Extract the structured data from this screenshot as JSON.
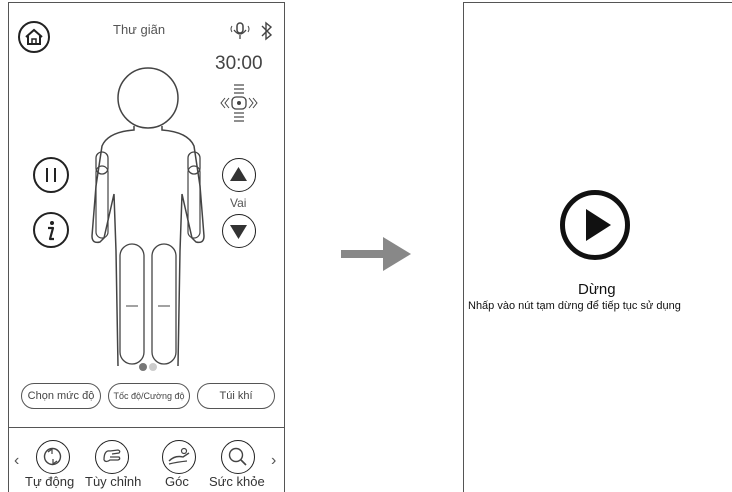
{
  "left": {
    "title": "Thư giãn",
    "timer": "30:00",
    "side_label": "Vai",
    "pager_dots": 2,
    "mode_buttons": [
      "Chọn mức độ",
      "Tốc độ/Cường độ",
      "Túi khí"
    ],
    "bottom_nav": [
      "Tự động",
      "Tùy chỉnh",
      "Góc",
      "Sức khỏe"
    ],
    "prev_arrow": "‹",
    "next_arrow": "›",
    "icons": {
      "home": "home-icon",
      "voice": "microphone-icon",
      "bluetooth": "bluetooth-icon",
      "pause": "pause-icon",
      "info": "info-icon"
    }
  },
  "right": {
    "status": "Dừng",
    "hint": "Nhấp vào nút tạm dừng để tiếp tục sử dụng"
  }
}
